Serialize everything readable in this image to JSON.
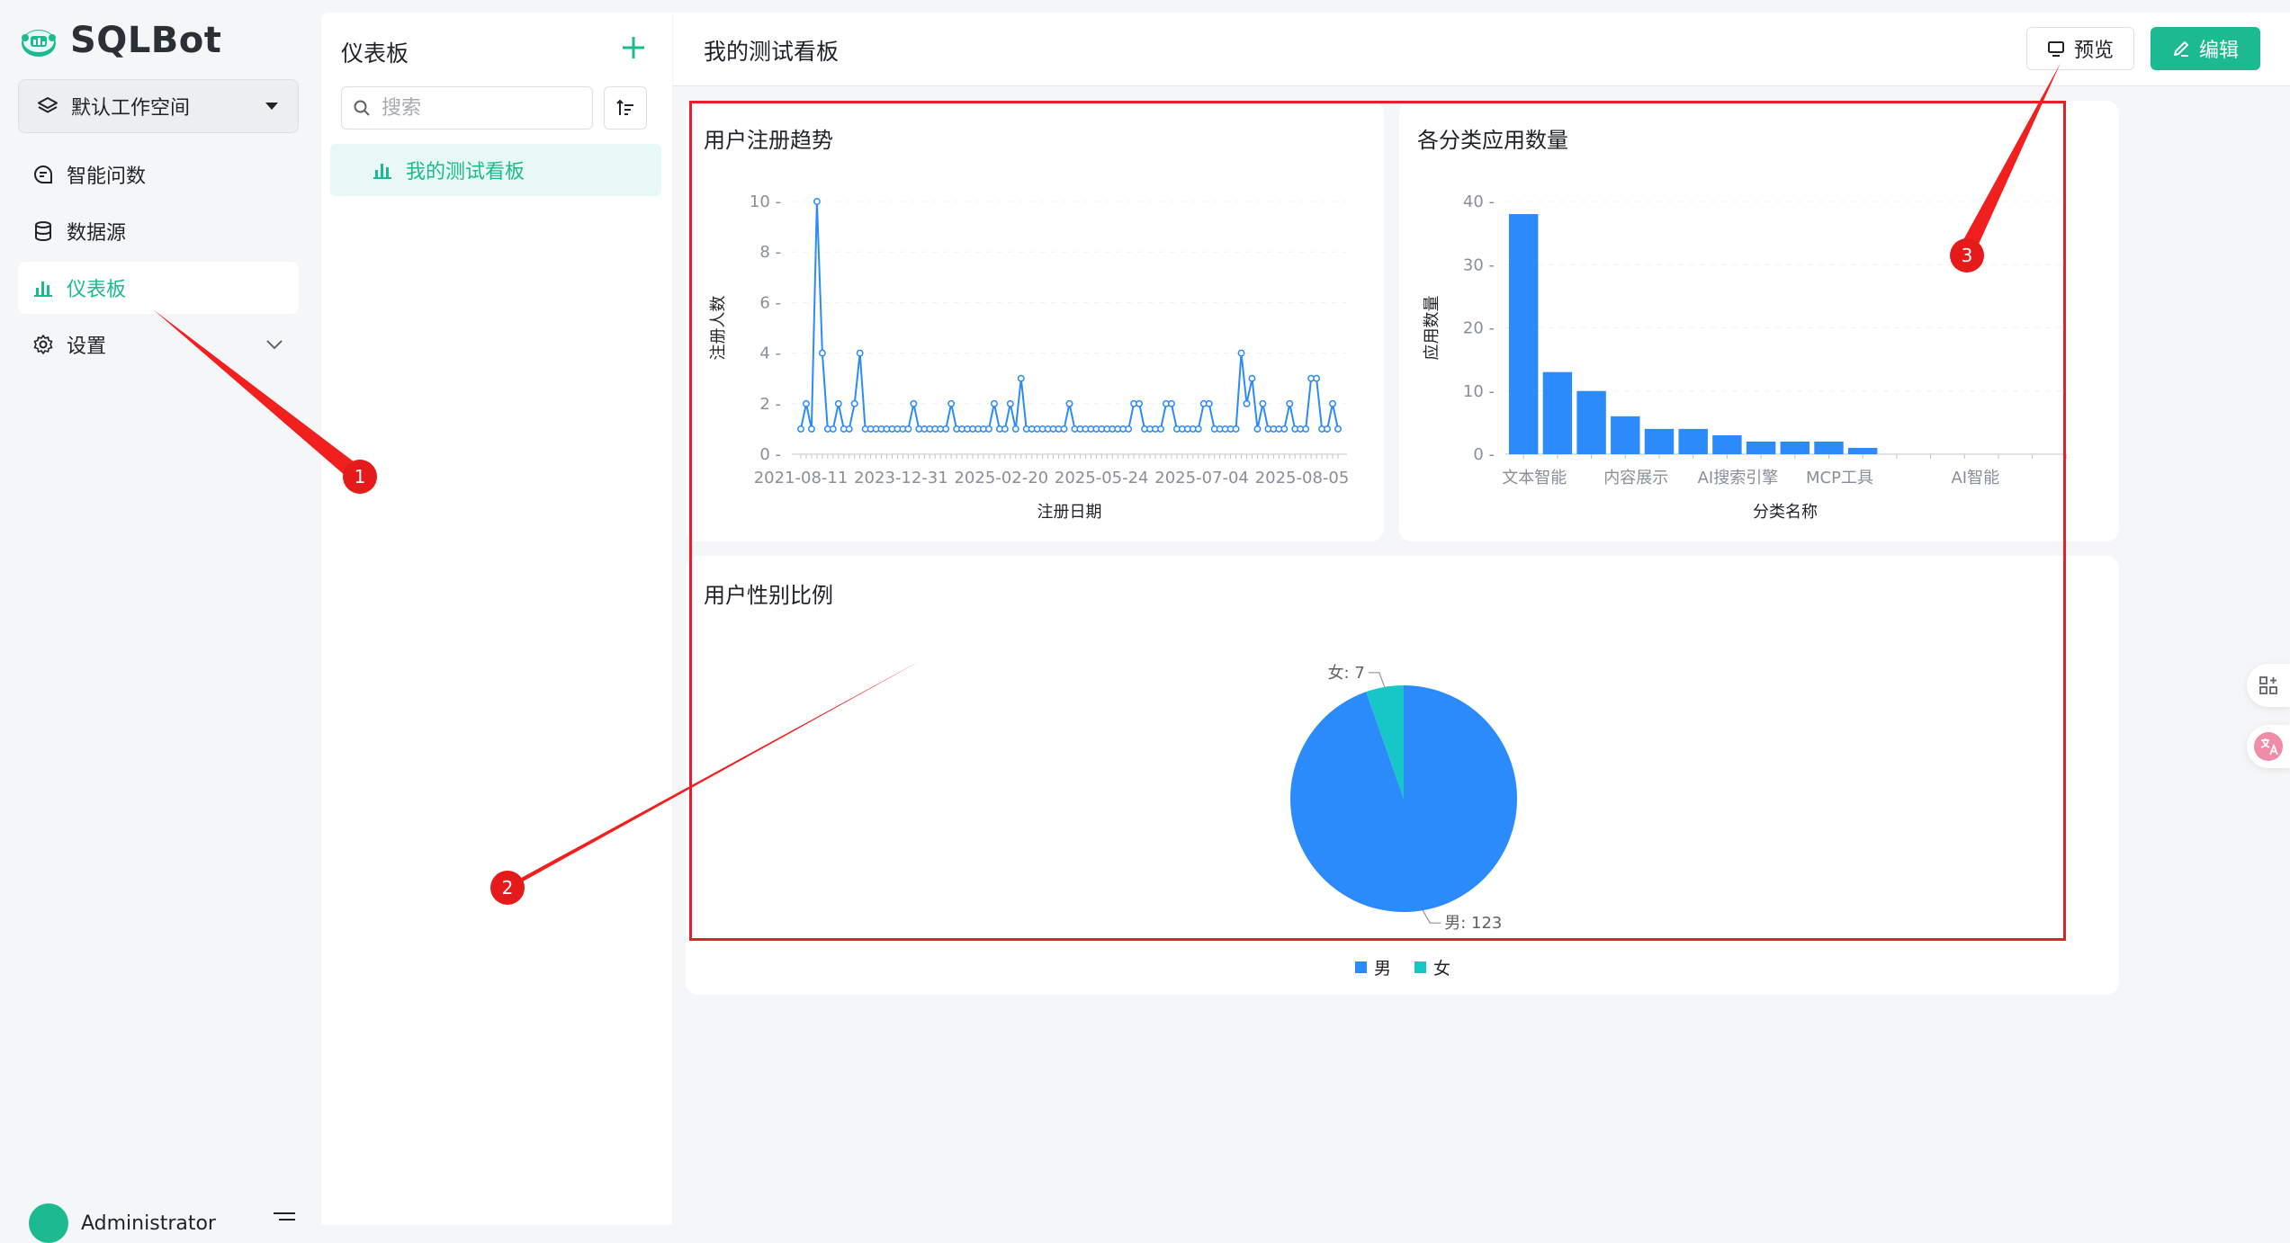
{
  "app": {
    "name": "SQLBot"
  },
  "sidebar": {
    "workspace": "默认工作空间",
    "items": [
      {
        "label": "智能问数"
      },
      {
        "label": "数据源"
      },
      {
        "label": "仪表板"
      },
      {
        "label": "设置"
      }
    ],
    "user": "Administrator"
  },
  "list_panel": {
    "title": "仪表板",
    "search_placeholder": "搜索",
    "items": [
      {
        "label": "我的测试看板"
      }
    ]
  },
  "header": {
    "title": "我的测试看板",
    "preview_label": "预览",
    "edit_label": "编辑"
  },
  "colors": {
    "accent": "#1cba90",
    "series": "#2b8bfb",
    "series2": "#17c6c6",
    "annotation": "#e5202b"
  },
  "annotations": [
    "1",
    "2",
    "3"
  ],
  "chart_data": [
    {
      "type": "line",
      "title": "用户注册趋势",
      "xlabel": "注册日期",
      "ylabel": "注册人数",
      "ylim": [
        0,
        10
      ],
      "yticks": [
        0,
        2,
        4,
        6,
        8,
        10
      ],
      "xtick_labels": [
        "2021-08-11",
        "2023-12-31",
        "2025-02-20",
        "2025-05-24",
        "2025-07-04",
        "2025-08-05"
      ],
      "values": [
        1,
        2,
        1,
        10,
        4,
        1,
        1,
        2,
        1,
        1,
        2,
        4,
        1,
        1,
        1,
        1,
        1,
        1,
        1,
        1,
        1,
        2,
        1,
        1,
        1,
        1,
        1,
        1,
        2,
        1,
        1,
        1,
        1,
        1,
        1,
        1,
        2,
        1,
        1,
        2,
        1,
        3,
        1,
        1,
        1,
        1,
        1,
        1,
        1,
        1,
        2,
        1,
        1,
        1,
        1,
        1,
        1,
        1,
        1,
        1,
        1,
        1,
        2,
        2,
        1,
        1,
        1,
        1,
        2,
        2,
        1,
        1,
        1,
        1,
        1,
        2,
        2,
        1,
        1,
        1,
        1,
        1,
        4,
        2,
        3,
        1,
        2,
        1,
        1,
        1,
        1,
        2,
        1,
        1,
        1,
        3,
        3,
        1,
        1,
        2,
        1
      ]
    },
    {
      "type": "bar",
      "title": "各分类应用数量",
      "xlabel": "分类名称",
      "ylabel": "应用数量",
      "ylim": [
        0,
        40
      ],
      "yticks": [
        0,
        10,
        20,
        30,
        40
      ],
      "categories": [
        "文本智能",
        "",
        "",
        "内容展示",
        "",
        "",
        "AI搜索引擎",
        "",
        "",
        "MCP工具",
        "",
        "",
        "",
        "AI智能",
        "",
        "",
        ""
      ],
      "values": [
        38,
        13,
        10,
        6,
        4,
        4,
        3,
        2,
        2,
        2,
        1,
        0,
        0,
        0,
        0,
        0,
        0
      ]
    },
    {
      "type": "pie",
      "title": "用户性别比例",
      "series": [
        {
          "name": "男",
          "value": 123,
          "label": "男: 123",
          "color": "#2b8bfb"
        },
        {
          "name": "女",
          "value": 7,
          "label": "女: 7",
          "color": "#17c6c6"
        }
      ]
    }
  ]
}
